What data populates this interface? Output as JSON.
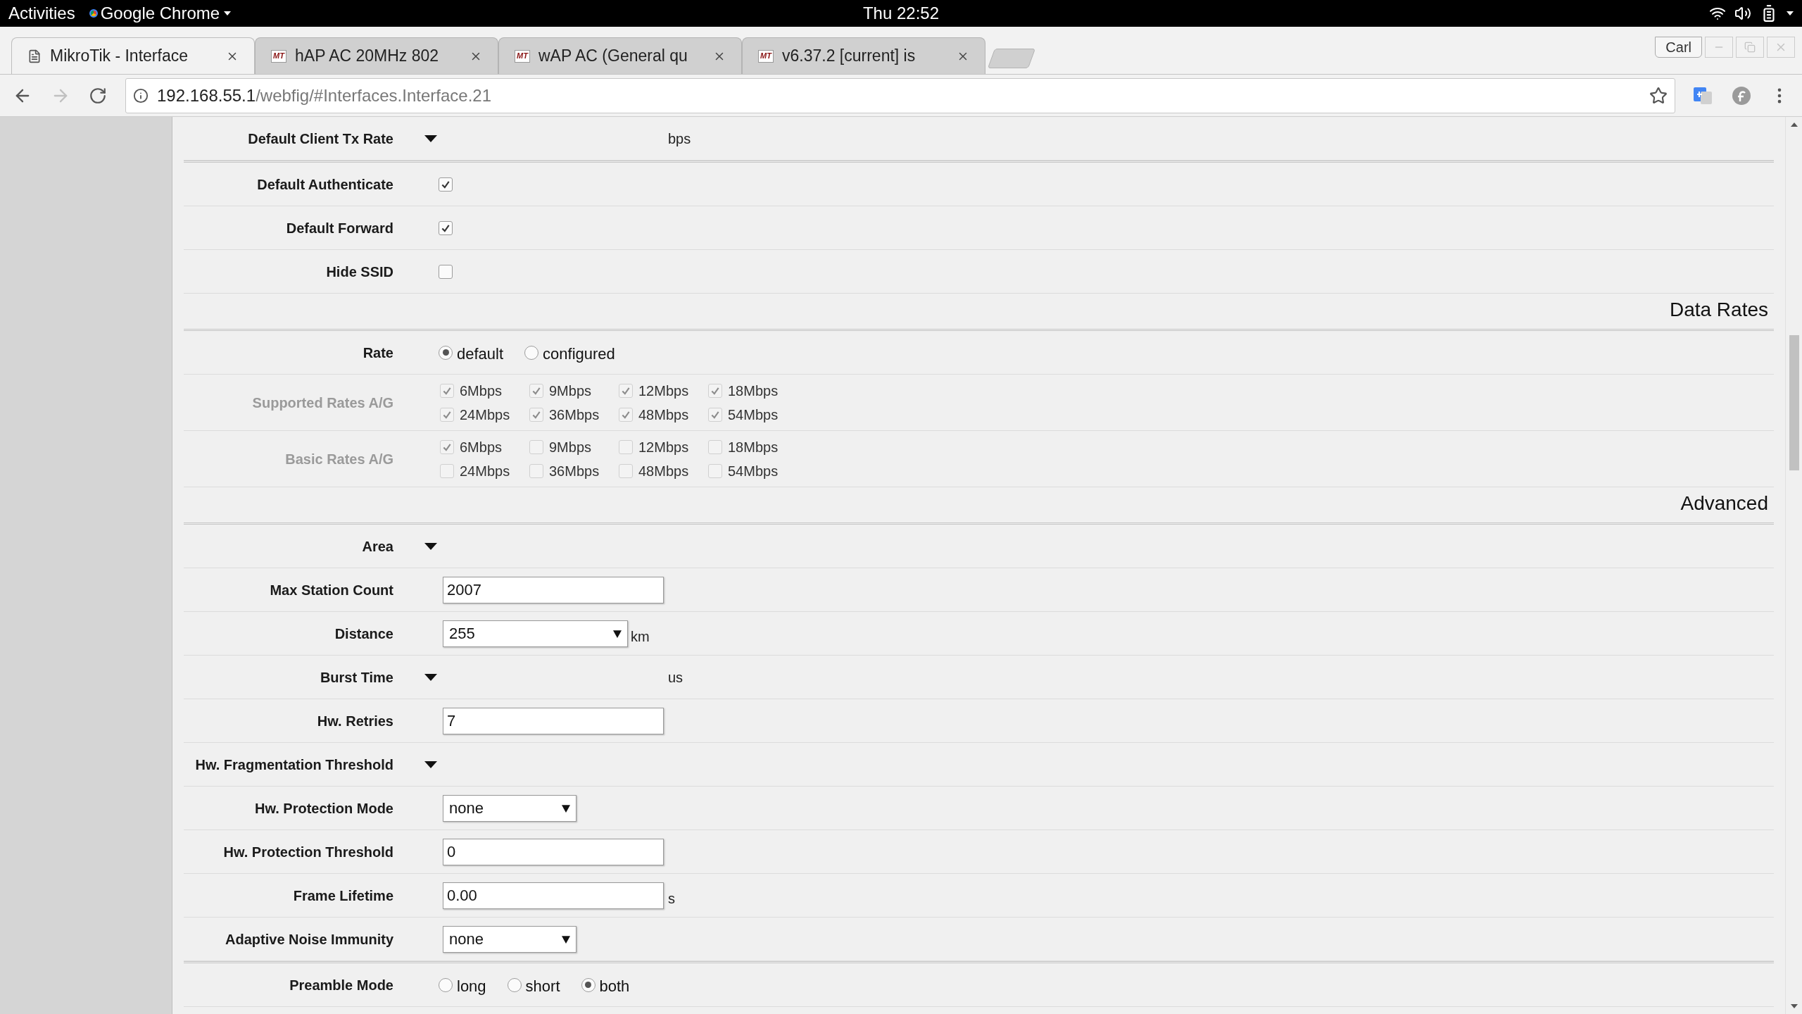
{
  "system_bar": {
    "activities": "Activities",
    "app": "Google Chrome",
    "clock": "Thu 22:52"
  },
  "browser": {
    "tabs": [
      {
        "title": "MikroTik - Interface",
        "kind": "document",
        "selected": true
      },
      {
        "title": "hAP AC 20MHz 802",
        "kind": "mt",
        "favicon_text": "MT",
        "selected": false
      },
      {
        "title": "wAP AC (General qu",
        "kind": "mt",
        "favicon_text": "MT",
        "selected": false
      },
      {
        "title": "v6.37.2 [current] is",
        "kind": "mt",
        "favicon_text": "MT",
        "selected": false
      }
    ],
    "profile": "Carl",
    "address": {
      "host": "192.168.55.1",
      "path": "/webfig/#Interfaces.Interface.21"
    }
  },
  "form": {
    "groups": [
      {
        "rows": [
          {
            "kind": "toggle",
            "label": "Default Client Tx Rate",
            "unit": "bps"
          }
        ]
      },
      {
        "rows": [
          {
            "kind": "checkbox",
            "label": "Default Authenticate",
            "checked": true
          },
          {
            "kind": "checkbox",
            "label": "Default Forward",
            "checked": true
          },
          {
            "kind": "checkbox",
            "label": "Hide SSID",
            "checked": false
          }
        ]
      },
      {
        "title": "Data Rates",
        "rows": [
          {
            "kind": "radio",
            "label": "Rate",
            "options": [
              {
                "label": "default",
                "selected": true
              },
              {
                "label": "configured",
                "selected": false
              }
            ]
          },
          {
            "kind": "checkgroup",
            "label": "Supported Rates A/G",
            "disabled": true,
            "options": [
              {
                "label": "6Mbps",
                "checked": true
              },
              {
                "label": "9Mbps",
                "checked": true
              },
              {
                "label": "12Mbps",
                "checked": true
              },
              {
                "label": "18Mbps",
                "checked": true
              },
              {
                "label": "24Mbps",
                "checked": true
              },
              {
                "label": "36Mbps",
                "checked": true
              },
              {
                "label": "48Mbps",
                "checked": true
              },
              {
                "label": "54Mbps",
                "checked": true
              }
            ]
          },
          {
            "kind": "checkgroup",
            "label": "Basic Rates A/G",
            "disabled": true,
            "options": [
              {
                "label": "6Mbps",
                "checked": true
              },
              {
                "label": "9Mbps",
                "checked": false
              },
              {
                "label": "12Mbps",
                "checked": false
              },
              {
                "label": "18Mbps",
                "checked": false
              },
              {
                "label": "24Mbps",
                "checked": false
              },
              {
                "label": "36Mbps",
                "checked": false
              },
              {
                "label": "48Mbps",
                "checked": false
              },
              {
                "label": "54Mbps",
                "checked": false
              }
            ]
          }
        ]
      },
      {
        "title": "Advanced",
        "rows": [
          {
            "kind": "toggle",
            "label": "Area"
          },
          {
            "kind": "input",
            "label": "Max Station Count",
            "value": "2007"
          },
          {
            "kind": "combo",
            "label": "Distance",
            "value": "255",
            "unit": "km"
          },
          {
            "kind": "toggle",
            "label": "Burst Time",
            "unit": "us"
          },
          {
            "kind": "input",
            "label": "Hw. Retries",
            "value": "7"
          },
          {
            "kind": "toggle",
            "label": "Hw. Fragmentation Threshold"
          },
          {
            "kind": "select",
            "label": "Hw. Protection Mode",
            "value": "none"
          },
          {
            "kind": "input",
            "label": "Hw. Protection Threshold",
            "value": "0"
          },
          {
            "kind": "input",
            "label": "Frame Lifetime",
            "value": "0.00",
            "unit": "s"
          },
          {
            "kind": "select",
            "label": "Adaptive Noise Immunity",
            "value": "none"
          }
        ]
      },
      {
        "rows": [
          {
            "kind": "radio",
            "label": "Preamble Mode",
            "options": [
              {
                "label": "long",
                "selected": false
              },
              {
                "label": "short",
                "selected": false
              },
              {
                "label": "both",
                "selected": true
              }
            ]
          }
        ]
      }
    ]
  }
}
